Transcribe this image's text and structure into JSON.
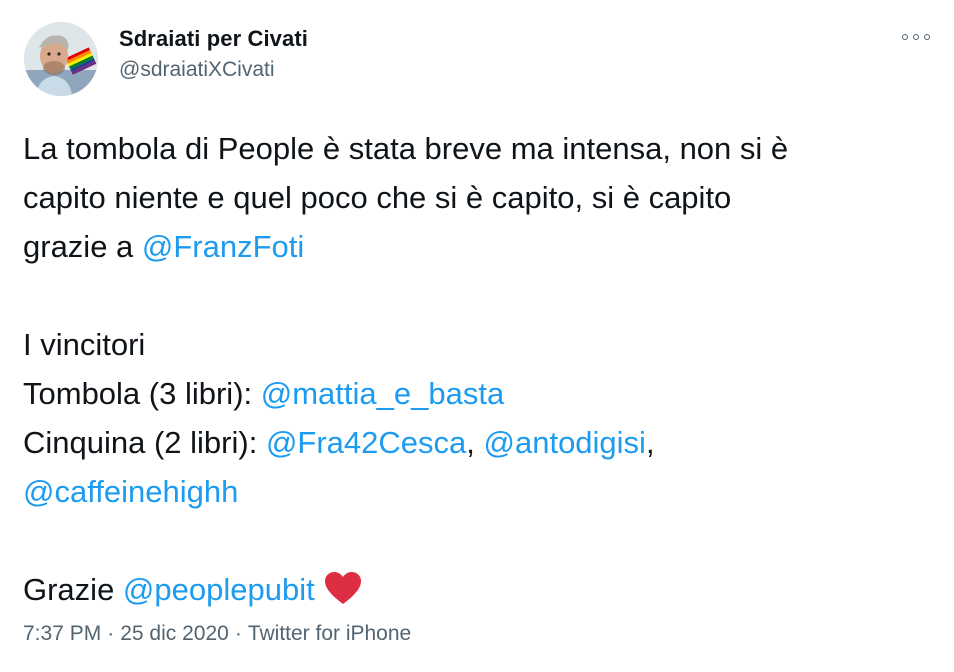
{
  "user": {
    "display_name": "Sdraiati per Civati",
    "handle": "@sdraiatiXCivati",
    "avatar_icon": "avatar-photo-with-rainbow-flag"
  },
  "menu": {
    "icon": "more-options-icon"
  },
  "tweet": {
    "line1_text": "La tombola di People è stata breve ma intensa, non si è",
    "line2_text": "capito niente e quel poco che si è capito, si è capito",
    "line3_prefix": "grazie a ",
    "mention_franzfoti": "@FranzFoti",
    "winners_heading": "I vincitori",
    "tombola_prefix": "Tombola (3 libri): ",
    "mention_mattia": "@mattia_e_basta",
    "cinquina_prefix": "Cinquina (2 libri): ",
    "mention_fra42": "@Fra42Cesca",
    "comma1": ", ",
    "mention_antodigisi": "@antodigisi",
    "comma2": ",",
    "mention_caffeine": "@caffeinehighh",
    "thanks_prefix": "Grazie ",
    "mention_peoplepub": "@peoplepubit",
    "heart_icon": "red-heart-emoji",
    "heart_color": "#dd2e44"
  },
  "meta": {
    "time": "7:37 PM",
    "separator1": "·",
    "date": "25 dic 2020",
    "separator2": "·",
    "source": "Twitter for iPhone"
  },
  "colors": {
    "link": "#1d9bf0",
    "secondary_text": "#536471",
    "primary_text": "#0f1419"
  }
}
